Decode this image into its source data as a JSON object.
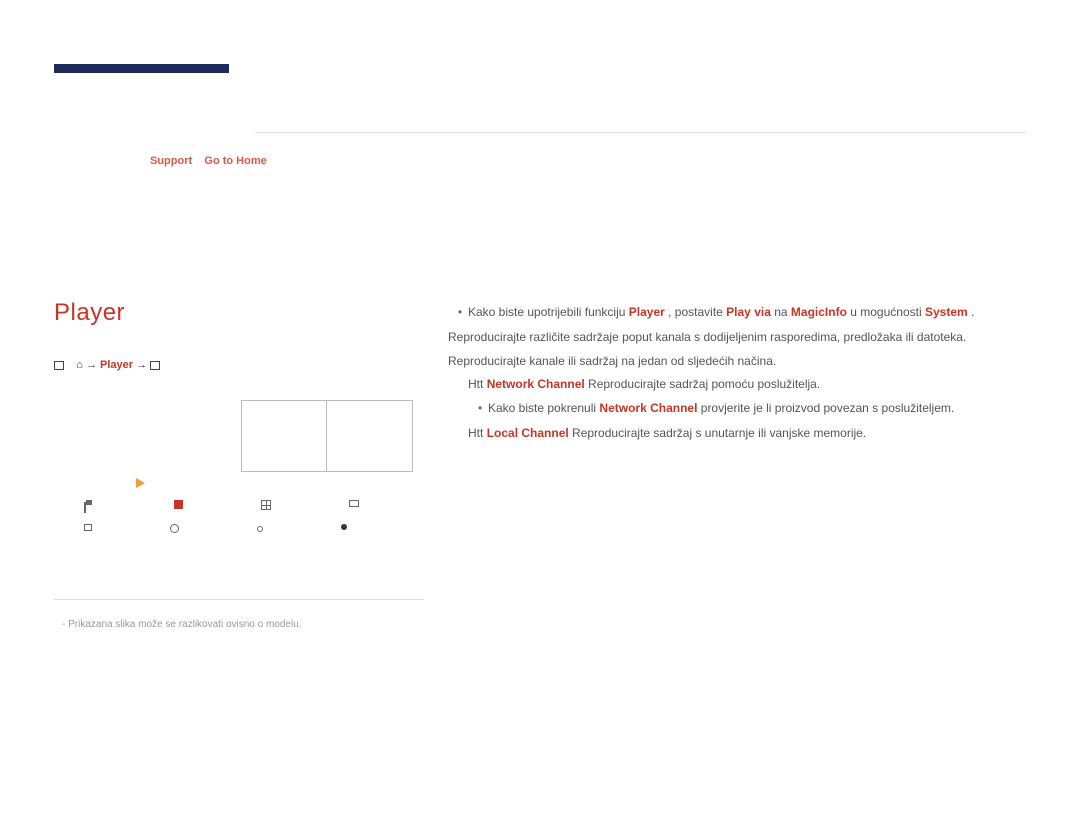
{
  "breadcrumb": {
    "support": "Support",
    "goto": "Go to Home"
  },
  "player": {
    "title": "Player",
    "nav_label": "Player"
  },
  "footnote": "-  Prikazana slika može se razlikovati ovisno o modelu.",
  "content": {
    "bullet1_prefix": "Kako biste upotrijebili funkciju ",
    "bullet1_term1": "Player",
    "bullet1_mid1": ", postavite ",
    "bullet1_term2": "Play via",
    "bullet1_mid2": " na ",
    "bullet1_term3": "MagicInfo",
    "bullet1_mid3": " u mogućnosti ",
    "bullet1_term4": "System",
    "bullet1_end": ".",
    "para1": "Reproducirajte različite sadržaje poput kanala s dodijeljenim rasporedima, predložaka ili datoteka.",
    "para2": "Reproducirajte kanale ili sadržaj na jedan od sljedećih načina.",
    "item1_prefix": "Htt",
    "item1_term": "Network Channel",
    "item1_text": "Reproducirajte sadržaj pomoću poslužitelja.",
    "sub1_prefix": "Kako biste pokrenuli ",
    "sub1_term": "Network Channel",
    "sub1_text": " provjerite je li proizvod povezan s poslužiteljem.",
    "item2_prefix": "Htt",
    "item2_term": "Local Channel",
    "item2_text": "Reproducirajte sadržaj s unutarnje ili vanjske memorije."
  }
}
